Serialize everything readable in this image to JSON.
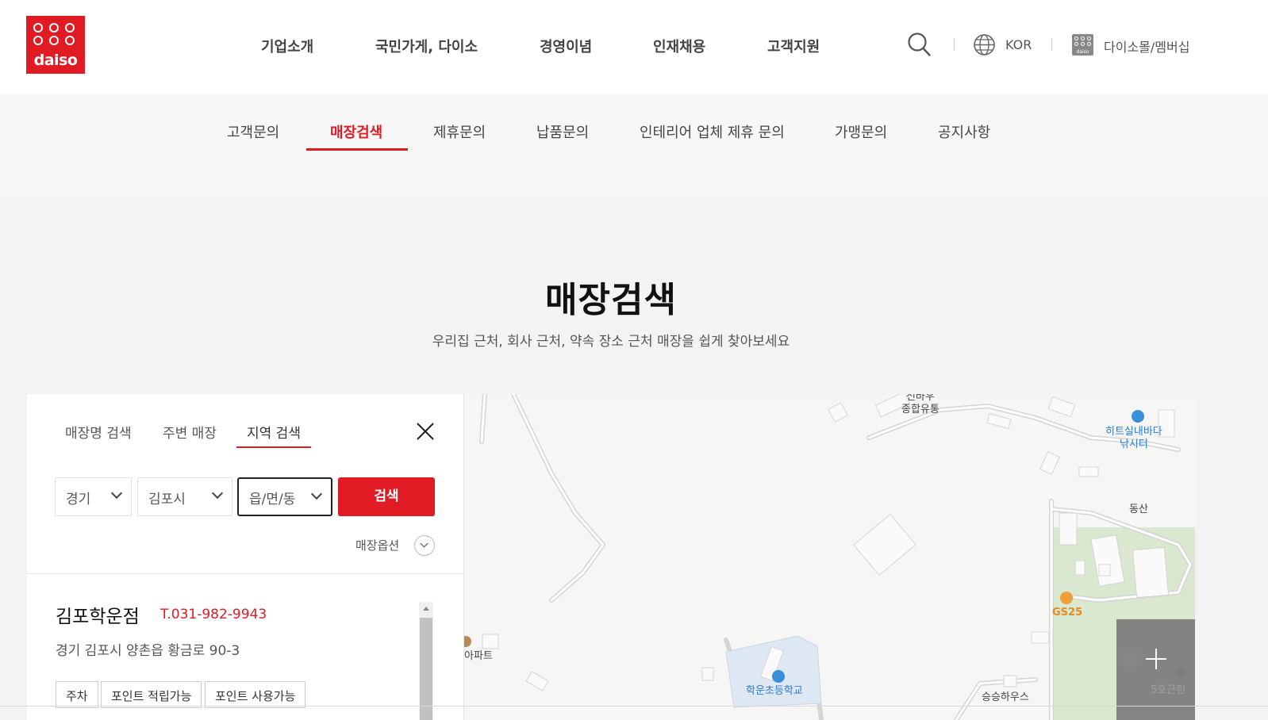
{
  "brand": {
    "logo_text": "daiso",
    "color": "#e11b24"
  },
  "gnb": [
    "기업소개",
    "국민가게, 다이소",
    "경영이념",
    "인재채용",
    "고객지원"
  ],
  "util": {
    "lang": "KOR",
    "mall": "다이소몰/멤버십"
  },
  "subnav": {
    "items": [
      "고객문의",
      "매장검색",
      "제휴문의",
      "납품문의",
      "인테리어 업체 제휴 문의",
      "가맹문의",
      "공지사항"
    ],
    "active": "매장검색"
  },
  "page": {
    "title": "매장검색",
    "subtitle": "우리집 근처, 회사 근처, 약속 장소 근처 매장을 쉽게 찾아보세요"
  },
  "search": {
    "tabs": [
      "매장명 검색",
      "주변 매장",
      "지역 검색"
    ],
    "active_tab": "지역 검색",
    "selects": [
      "경기",
      "김포시",
      "읍/면/동"
    ],
    "button": "검색",
    "options_label": "매장옵션"
  },
  "store": {
    "name": "김포학운점",
    "tel": "T.031-982-9943",
    "address": "경기 김포시 양촌읍 황금로 90-3",
    "badges": [
      "주차",
      "포인트 적립가능",
      "포인트 사용가능"
    ]
  },
  "map": {
    "labels": {
      "market": "신바우\n종합유통",
      "fishing": "히트실내바다\n낚시터",
      "hill": "동산",
      "gs25": "GS25",
      "apt": "아파트",
      "school": "학운초등학교",
      "house": "승승하우스",
      "shop": "5호근린"
    }
  }
}
